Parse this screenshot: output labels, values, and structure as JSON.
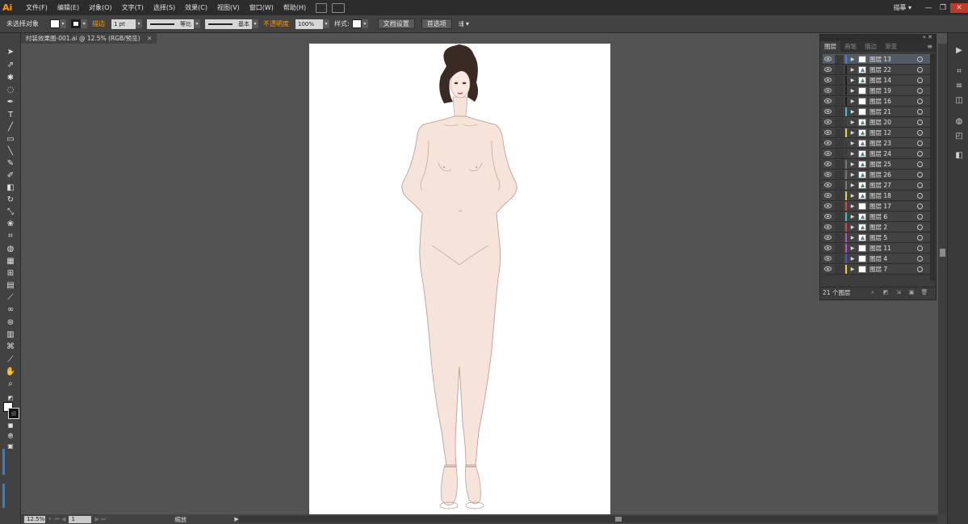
{
  "app": {
    "logo": "Ai"
  },
  "menu": {
    "items": [
      "文件(F)",
      "编辑(E)",
      "对象(O)",
      "文字(T)",
      "选择(S)",
      "效果(C)",
      "视图(V)",
      "窗口(W)",
      "帮助(H)"
    ],
    "workspace": "描摹"
  },
  "window_controls": {
    "minimize": "—",
    "restore": "❐",
    "close": "✕"
  },
  "controlbar": {
    "selection_status": "未选择对象",
    "stroke_label": "描边",
    "stroke_weight": "1 pt",
    "stroke_profile_1": "等比",
    "stroke_profile_2": "基本",
    "opacity_label": "不透明度",
    "opacity_value": "100%",
    "style_label": "样式:",
    "doc_setup_button": "文档设置",
    "preferences_button": "首选项"
  },
  "document": {
    "tab_title": "时装效果图-001.ai @ 12.5% (RGB/预览)",
    "tab_close": "✕"
  },
  "statusbar": {
    "zoom": "12.5%",
    "page": "1",
    "status_text": "缩放"
  },
  "layers_panel": {
    "tabs": [
      "图层",
      "画笔",
      "描边",
      "渐变"
    ],
    "menu_icon": "≡",
    "collapse_icon": "« ✕",
    "layer_count": "21 个图层",
    "layers": [
      {
        "name": "图层 13",
        "color": "#4f7cd1",
        "selected": true,
        "thumb": "blank"
      },
      {
        "name": "图层 22",
        "color": "#1f1f1f",
        "selected": false,
        "thumb": "ink"
      },
      {
        "name": "图层 14",
        "color": "#1f1f1f",
        "selected": false,
        "thumb": "ink"
      },
      {
        "name": "图层 19",
        "color": "#1f1f1f",
        "selected": false,
        "thumb": "blank"
      },
      {
        "name": "图层 16",
        "color": "#1f1f1f",
        "selected": false,
        "thumb": "blank"
      },
      {
        "name": "图层 21",
        "color": "#3cc0c0",
        "selected": false,
        "thumb": "blank"
      },
      {
        "name": "图层 20",
        "color": "#3c3c3c",
        "selected": false,
        "thumb": "ink"
      },
      {
        "name": "图层 12",
        "color": "#e0d238",
        "selected": false,
        "thumb": "ink"
      },
      {
        "name": "图层 23",
        "color": "#3c3c3c",
        "selected": false,
        "thumb": "ink"
      },
      {
        "name": "图层 24",
        "color": "#3c3c3c",
        "selected": false,
        "thumb": "ink"
      },
      {
        "name": "图层 25",
        "color": "#777777",
        "selected": false,
        "thumb": "ink"
      },
      {
        "name": "图层 26",
        "color": "#777777",
        "selected": false,
        "thumb": "ink"
      },
      {
        "name": "图层 27",
        "color": "#777777",
        "selected": false,
        "thumb": "ink"
      },
      {
        "name": "图层 18",
        "color": "#e0d238",
        "selected": false,
        "thumb": "ink"
      },
      {
        "name": "图层 17",
        "color": "#d04848",
        "selected": false,
        "thumb": "blank"
      },
      {
        "name": "图层 6",
        "color": "#3cc0c0",
        "selected": false,
        "thumb": "ink"
      },
      {
        "name": "图层 2",
        "color": "#d04848",
        "selected": false,
        "thumb": "ink"
      },
      {
        "name": "图层 5",
        "color": "#c050c8",
        "selected": false,
        "thumb": "ink"
      },
      {
        "name": "图层 11",
        "color": "#c050c8",
        "selected": false,
        "thumb": "blank"
      },
      {
        "name": "图层 4",
        "color": "#4f4fd1",
        "selected": false,
        "thumb": "blank"
      },
      {
        "name": "图层 7",
        "color": "#e0d238",
        "selected": false,
        "thumb": "blank"
      }
    ]
  },
  "colors": {
    "accent": "#ff9a00",
    "skin": "#f6e3da",
    "outline": "#b8958a",
    "hair": "#3a2a24"
  }
}
